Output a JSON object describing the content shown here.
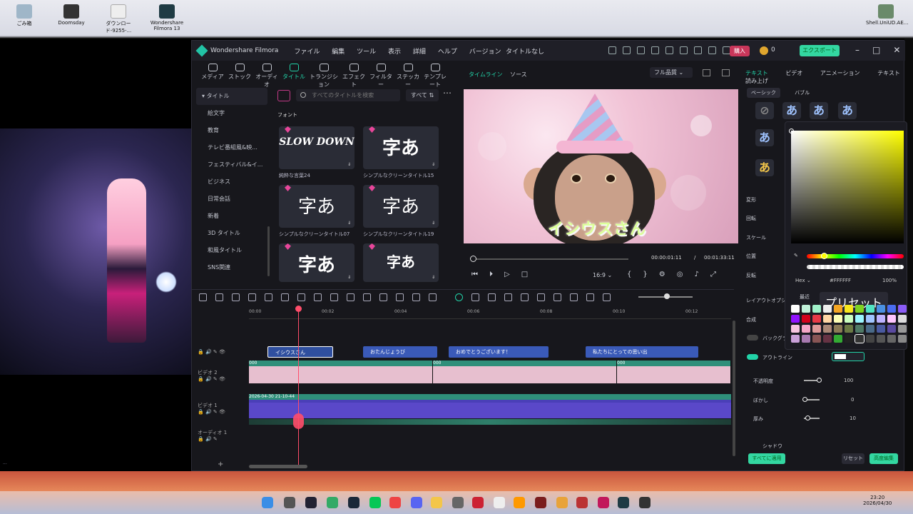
{
  "desktop": {
    "icons": [
      "ごみ箱",
      "Doomsday",
      "ダウンロード-9255-...",
      "Wondershare Filmora 13"
    ],
    "right_icon": "Shell.UniUD.AE...",
    "bg_text": "..."
  },
  "app": {
    "title": "Wondershare Filmora",
    "document": "タイトルなし",
    "menu": [
      "ファイル",
      "編集",
      "ツール",
      "表示",
      "詳細",
      "ヘルプ",
      "バージョン"
    ],
    "buy": "購入",
    "coins": "0",
    "export": "エクスポート"
  },
  "toolbar": [
    "メディア",
    "ストック",
    "オーディオ",
    "タイトル",
    "トランジション",
    "エフェクト",
    "フィルター",
    "ステッカー",
    "テンプレート"
  ],
  "categories": [
    "タイトル",
    "絵文字",
    "教育",
    "テレビ番組風&映...",
    "フェスティバル&イ...",
    "ビジネス",
    "日常会話",
    "新着",
    "3D タイトル",
    "和風タイトル",
    "SNS関連"
  ],
  "search": {
    "placeholder": "すべてのタイトルを検索",
    "filter": "すべて"
  },
  "font_label": "フォント",
  "cards": [
    {
      "glyph": "SLOW DOWN",
      "caption": "純粋な言葉24"
    },
    {
      "glyph": "字あ",
      "caption": "シンプルなクリーンタイトル15"
    },
    {
      "glyph": "字あ",
      "caption": "シンプルなクリーンタイトル07"
    },
    {
      "glyph": "字あ",
      "caption": "シンプルなクリーンタイトル19"
    },
    {
      "glyph": "字あ",
      "caption": ""
    },
    {
      "glyph": "字あ",
      "caption": ""
    }
  ],
  "preview": {
    "tabs": [
      "タイムライン",
      "ソース"
    ],
    "quality": "フル品質",
    "caption": "イシウスさん",
    "current": "00:00:01:11",
    "sep": "/",
    "total": "00:01:33:11",
    "ratio": "16:9"
  },
  "ruler": [
    "00:00",
    "00:02",
    "00:04",
    "00:06",
    "00:08",
    "00:10",
    "00:12"
  ],
  "tracks": {
    "title_clips": [
      "イシウスさん",
      "おたんじょうび",
      "おめでとうございます！",
      "私たちにとっての思い出"
    ],
    "video2": "ビデオ 2",
    "video1": "ビデオ 1",
    "audio1": "オーディオ 1",
    "clip_label": "000",
    "clip2_label": "2026-04-30 21-10-44"
  },
  "right": {
    "tabs": [
      "テキスト",
      "ビデオ",
      "アニメーション",
      "テキスト読み上げ"
    ],
    "sub": [
      "ベーシック",
      "バブル"
    ],
    "labels": [
      "変形",
      "回転",
      "スケール",
      "位置",
      "反転",
      "レイアウトオプシ...",
      "合成",
      "バックグラ...",
      "アウトライン",
      "不透明度",
      "ぼかし",
      "厚み",
      "シャドウ"
    ],
    "opacity": "100",
    "blur": "0",
    "thickness": "10",
    "apply_all": "すべてに適用",
    "reset": "リセット",
    "advanced": "高度編集"
  },
  "picker": {
    "mode": "Hex",
    "hex": "#FFFFFF",
    "alpha": "100%",
    "tab_recent": "最近",
    "tab_preset": "プリセット"
  },
  "taskbar": {
    "time": "23:20",
    "date": "2026/04/30"
  }
}
